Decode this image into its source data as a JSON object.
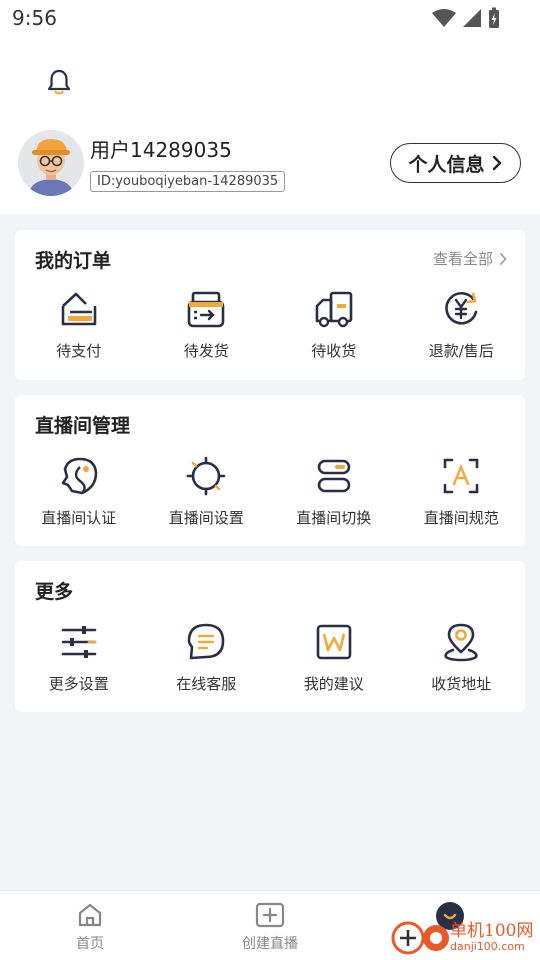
{
  "status": {
    "time": "9:56"
  },
  "user": {
    "name": "用户14289035",
    "id": "ID:youboqiyeban-14289035",
    "profile_button": "个人信息"
  },
  "orders": {
    "title": "我的订单",
    "view_all": "查看全部",
    "items": [
      {
        "label": "待支付",
        "icon": "pending-payment-icon"
      },
      {
        "label": "待发货",
        "icon": "pending-shipment-icon"
      },
      {
        "label": "待收货",
        "icon": "pending-receipt-icon"
      },
      {
        "label": "退款/售后",
        "icon": "refund-icon"
      }
    ]
  },
  "live": {
    "title": "直播间管理",
    "items": [
      {
        "label": "直播间认证",
        "icon": "live-auth-icon"
      },
      {
        "label": "直播间设置",
        "icon": "live-settings-icon"
      },
      {
        "label": "直播间切换",
        "icon": "live-switch-icon"
      },
      {
        "label": "直播间规范",
        "icon": "live-rules-icon"
      }
    ]
  },
  "more": {
    "title": "更多",
    "items": [
      {
        "label": "更多设置",
        "icon": "sliders-icon"
      },
      {
        "label": "在线客服",
        "icon": "chat-icon"
      },
      {
        "label": "我的建议",
        "icon": "suggestion-icon"
      },
      {
        "label": "收货地址",
        "icon": "location-icon"
      }
    ]
  },
  "tabbar": {
    "home": "首页",
    "create_live": "创建直播"
  },
  "watermark": {
    "name": "单机100网",
    "url": "danji100.com"
  },
  "colors": {
    "accent": "#f0a93b",
    "ink": "#2b2f45"
  }
}
